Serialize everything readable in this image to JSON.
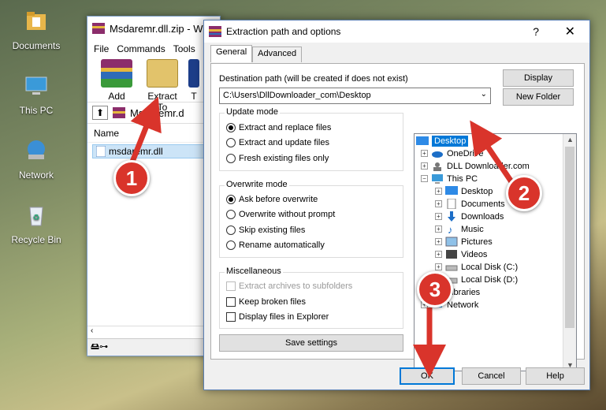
{
  "desktop": {
    "icons": [
      {
        "label": "Documents",
        "icon": "folder-icon"
      },
      {
        "label": "This PC",
        "icon": "computer-icon"
      },
      {
        "label": "Network",
        "icon": "network-icon"
      },
      {
        "label": "Recycle Bin",
        "icon": "recycle-bin-icon"
      }
    ]
  },
  "winrar": {
    "title": "Msdaremr.dll.zip - W",
    "menu": [
      "File",
      "Commands",
      "Tools"
    ],
    "tools": [
      {
        "label": "Add",
        "icon": "add-archive-icon"
      },
      {
        "label": "Extract To",
        "icon": "extract-to-icon"
      },
      {
        "label": "T",
        "icon": "test-icon"
      }
    ],
    "address": "Msdaremr.d",
    "list_header": "Name",
    "file": "msdaremr.dll"
  },
  "dialog": {
    "title": "Extraction path and options",
    "help": "?",
    "close": "✕",
    "tabs": [
      "General",
      "Advanced"
    ],
    "dest_label": "Destination path (will be created if does not exist)",
    "dest_value": "C:\\Users\\DllDownloader_com\\Desktop",
    "display_btn": "Display",
    "new_folder_btn": "New Folder",
    "update_mode": {
      "title": "Update mode",
      "options": [
        {
          "label": "Extract and replace files",
          "checked": true
        },
        {
          "label": "Extract and update files",
          "checked": false
        },
        {
          "label": "Fresh existing files only",
          "checked": false
        }
      ]
    },
    "overwrite_mode": {
      "title": "Overwrite mode",
      "options": [
        {
          "label": "Ask before overwrite",
          "checked": true
        },
        {
          "label": "Overwrite without prompt",
          "checked": false
        },
        {
          "label": "Skip existing files",
          "checked": false
        },
        {
          "label": "Rename automatically",
          "checked": false
        }
      ]
    },
    "misc": {
      "title": "Miscellaneous",
      "options": [
        {
          "label": "Extract archives to subfolders",
          "checked": false,
          "disabled": true
        },
        {
          "label": "Keep broken files",
          "checked": false,
          "disabled": false
        },
        {
          "label": "Display files in Explorer",
          "checked": false,
          "disabled": false
        }
      ]
    },
    "save_settings": "Save settings",
    "tree": [
      {
        "label": "Desktop",
        "selected": true
      },
      {
        "label": "OneDrive"
      },
      {
        "label": "DLL Downloader.com"
      },
      {
        "label": "This PC"
      },
      {
        "label": "Desktop"
      },
      {
        "label": "Documents"
      },
      {
        "label": "Downloads"
      },
      {
        "label": "Music"
      },
      {
        "label": "Pictures"
      },
      {
        "label": "Videos"
      },
      {
        "label": "Local Disk (C:)"
      },
      {
        "label": "Local Disk (D:)"
      },
      {
        "label": "Libraries"
      },
      {
        "label": "Network"
      }
    ],
    "ok": "OK",
    "cancel": "Cancel",
    "help_btn": "Help"
  },
  "annotations": [
    "1",
    "2",
    "3"
  ],
  "colors": {
    "accent": "#0078d7",
    "badge": "#d9342b"
  }
}
